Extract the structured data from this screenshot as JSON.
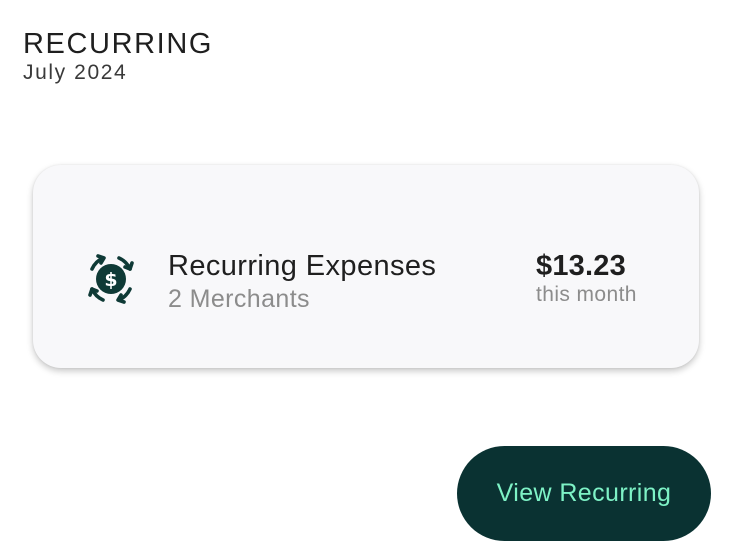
{
  "header": {
    "title": "RECURRING",
    "period": "July 2024"
  },
  "card": {
    "icon": "recurring-dollar-icon",
    "title": "Recurring Expenses",
    "subtitle": "2 Merchants",
    "amount": "$13.23",
    "amount_caption": "this month"
  },
  "actions": {
    "view_label": "View Recurring"
  },
  "colors": {
    "icon": "#0f3a36",
    "button_bg": "#0a3232",
    "button_text": "#7ef2c6",
    "card_bg": "#f8f8fa"
  }
}
